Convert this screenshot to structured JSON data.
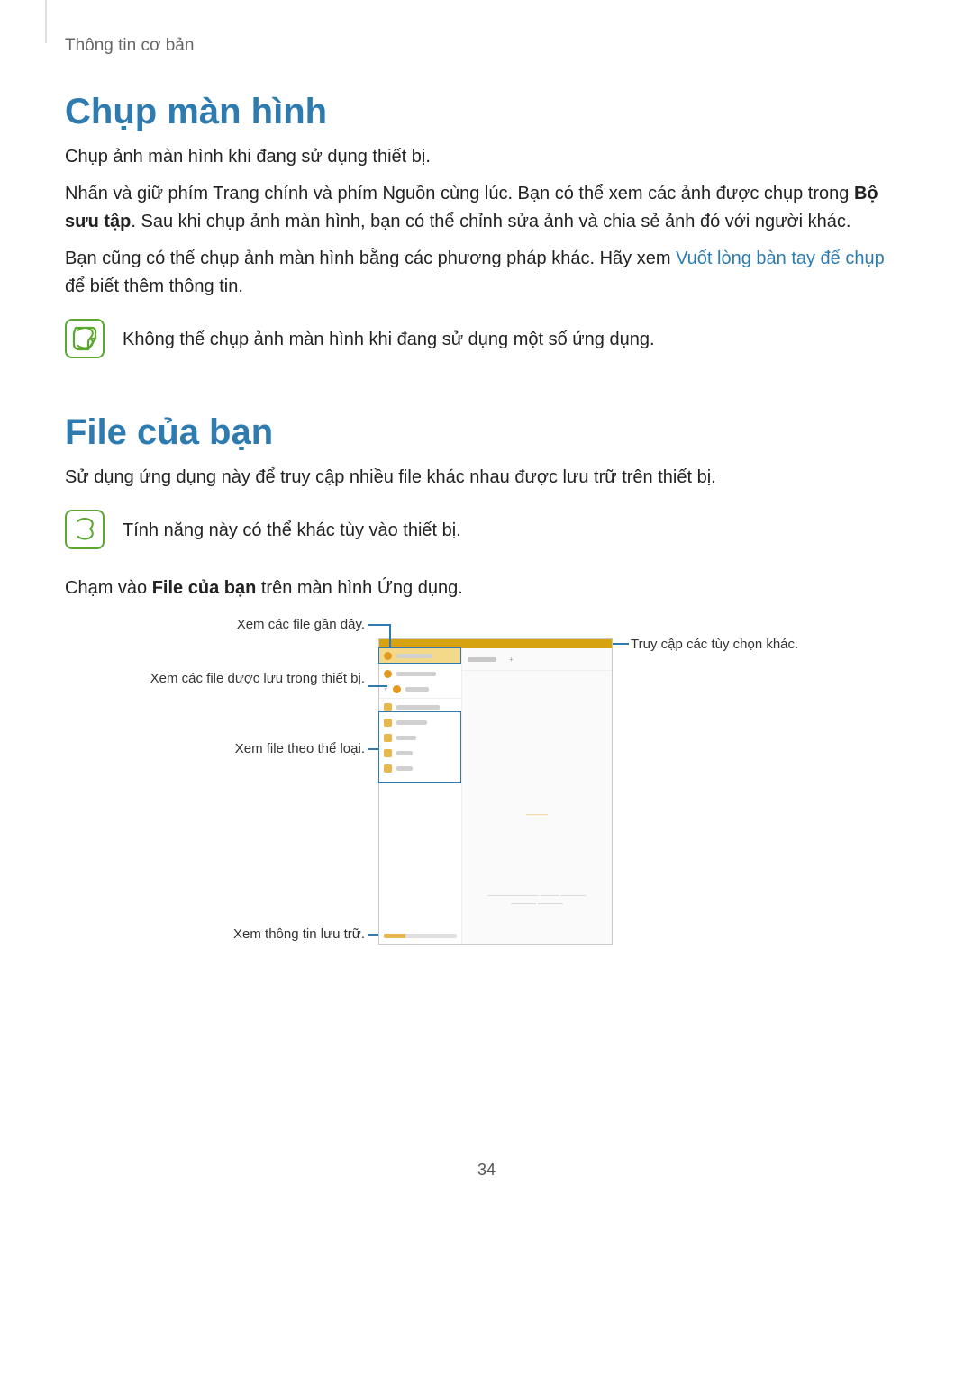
{
  "breadcrumb": "Thông tin cơ bản",
  "section1": {
    "heading": "Chụp màn hình",
    "p1": "Chụp ảnh màn hình khi đang sử dụng thiết bị.",
    "p2a": "Nhấn và giữ phím Trang chính và phím Nguồn cùng lúc. Bạn có thể xem các ảnh được chụp trong ",
    "p2b": "Bộ sưu tập",
    "p2c": ". Sau khi chụp ảnh màn hình, bạn có thể chỉnh sửa ảnh và chia sẻ ảnh đó với người khác.",
    "p3a": "Bạn cũng có thể chụp ảnh màn hình bằng các phương pháp khác. Hãy xem ",
    "p3link": "Vuốt lòng bàn tay để chụp",
    "p3b": " để biết thêm thông tin.",
    "note": "Không thể chụp ảnh màn hình khi đang sử dụng một số ứng dụng."
  },
  "section2": {
    "heading": "File của bạn",
    "p1": "Sử dụng ứng dụng này để truy cập nhiều file khác nhau được lưu trữ trên thiết bị.",
    "note": "Tính năng này có thể khác tùy vào thiết bị.",
    "p2a": "Chạm vào ",
    "p2b": "File của bạn",
    "p2c": " trên màn hình Ứng dụng."
  },
  "figure": {
    "callout_recent": "Xem các file gần đây.",
    "callout_device": "Xem các file được lưu trong thiết bị.",
    "callout_category": "Xem file theo thể loại.",
    "callout_storage": "Xem thông tin lưu trữ.",
    "callout_options": "Truy cập các tùy chọn khác.",
    "tab_plus": "+"
  },
  "page_number": "34"
}
